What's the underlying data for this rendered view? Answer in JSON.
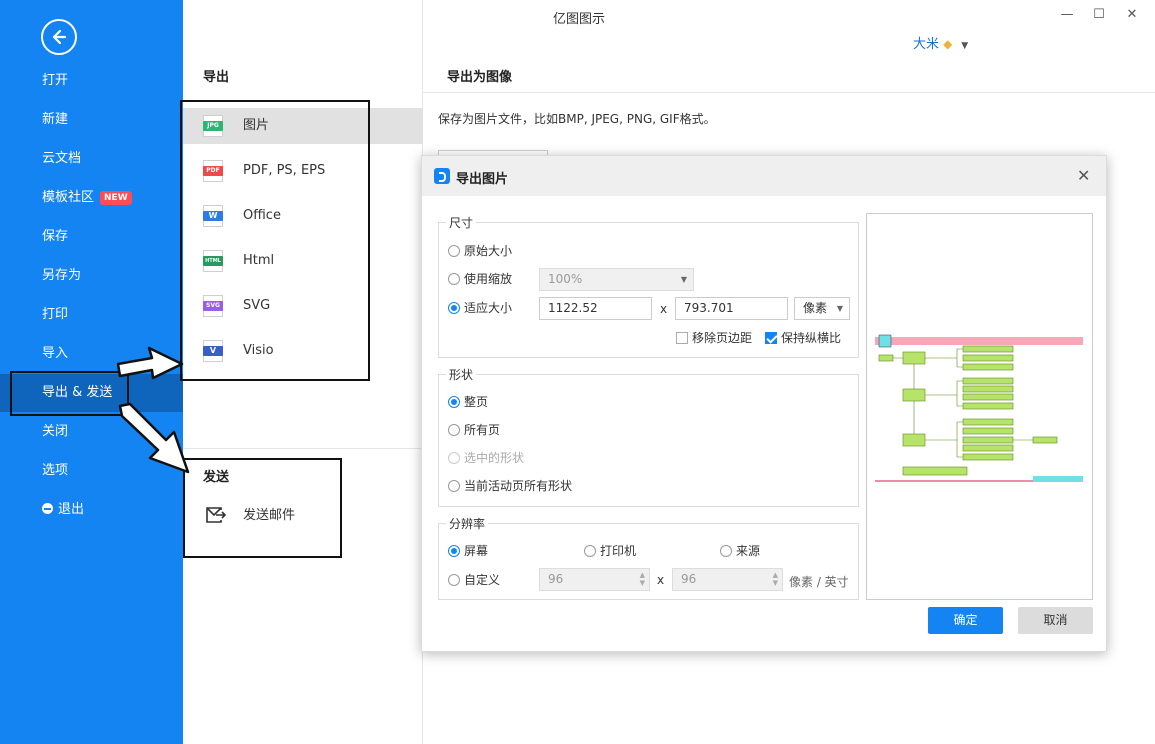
{
  "window": {
    "title": "亿图图示",
    "user_name": "大米",
    "minimize": "—",
    "maximize": "☐",
    "close": "✕"
  },
  "sidebar": {
    "items": [
      {
        "label": "打开"
      },
      {
        "label": "新建"
      },
      {
        "label": "云文档"
      },
      {
        "label": "模板社区",
        "badge": "NEW"
      },
      {
        "label": "保存"
      },
      {
        "label": "另存为"
      },
      {
        "label": "打印"
      },
      {
        "label": "导入"
      },
      {
        "label": "导出 & 发送"
      },
      {
        "label": "关闭"
      },
      {
        "label": "选项"
      },
      {
        "label": "退出"
      }
    ]
  },
  "export_panel": {
    "title": "导出",
    "items": [
      {
        "label": "图片",
        "tag": "JPG"
      },
      {
        "label": "PDF, PS, EPS",
        "tag": "PDF"
      },
      {
        "label": "Office",
        "tag": "W"
      },
      {
        "label": "Html",
        "tag": "HTML"
      },
      {
        "label": "SVG",
        "tag": "SVG"
      },
      {
        "label": "Visio",
        "tag": "V"
      }
    ],
    "send_title": "发送",
    "send_email": "发送邮件"
  },
  "content": {
    "title": "导出为图像",
    "description": "保存为图片文件，比如BMP, JPEG, PNG, GIF格式。"
  },
  "dialog": {
    "title": "导出图片",
    "size": {
      "label": "尺寸",
      "original": "原始大小",
      "use_zoom": "使用缩放",
      "zoom_value": "100%",
      "fit_size": "适应大小",
      "width": "1122.52",
      "height": "793.701",
      "times": "x",
      "unit": "像素",
      "remove_margin": "移除页边距",
      "keep_ratio": "保持纵横比"
    },
    "shape": {
      "label": "形状",
      "whole_page": "整页",
      "all_pages": "所有页",
      "selected_shapes": "选中的形状",
      "current_page_shapes": "当前活动页所有形状"
    },
    "resolution": {
      "label": "分辨率",
      "screen": "屏幕",
      "printer": "打印机",
      "source": "来源",
      "custom": "自定义",
      "dpi_x": "96",
      "dpi_y": "96",
      "times": "x",
      "unit": "像素 / 英寸"
    },
    "ok": "确定",
    "cancel": "取消"
  },
  "colors": {
    "sidebar_blue": "#1384f1",
    "sidebar_active": "#0f64bb",
    "primary_button": "#1384f1"
  }
}
